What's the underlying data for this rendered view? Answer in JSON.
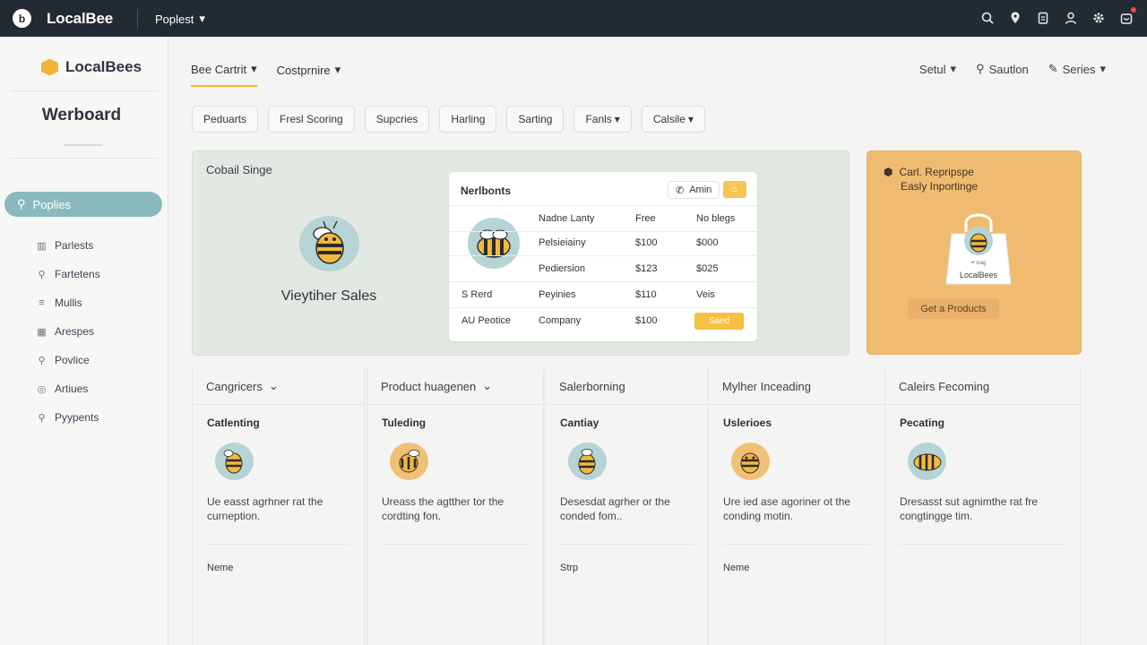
{
  "topbar": {
    "brand": "LocalBee",
    "project": "Poplest"
  },
  "sidebar": {
    "logo": "LocalBees",
    "title": "Werboard",
    "active": "Poplies",
    "items": [
      {
        "label": "Parlests",
        "icon": "chart-icon"
      },
      {
        "label": "Fartetens",
        "icon": "search-icon"
      },
      {
        "label": "Mullis",
        "icon": "list-icon"
      },
      {
        "label": "Arespes",
        "icon": "grid-icon"
      },
      {
        "label": "Povlice",
        "icon": "search-icon"
      },
      {
        "label": "Artiues",
        "icon": "target-icon"
      },
      {
        "label": "Pyypents",
        "icon": "pin-icon"
      }
    ]
  },
  "subnav": {
    "tabs": [
      {
        "label": "Bee Cartrit"
      },
      {
        "label": "Costprnire"
      }
    ],
    "right": {
      "setup": "Setul",
      "search": "Sautlon",
      "series": "Series"
    }
  },
  "chips": [
    "Peduarts",
    "Fresl Scoring",
    "Supcries",
    "Harling",
    "Sarting",
    "Fanls",
    "Calsile"
  ],
  "hero": {
    "label": "Cobail Singe",
    "sales_title": "Vieytiher Sales",
    "card": {
      "title": "Nerlbonts",
      "admin": "Amin",
      "headers": [
        "",
        "Nadne Lanty",
        "Free",
        "No blegs"
      ],
      "rows": [
        [
          "",
          "Pelsieiainy",
          "$100",
          "$000"
        ],
        [
          "",
          "Pediersion",
          "$123",
          "$025"
        ],
        [
          "S Rerd",
          "Peyinies",
          "$110",
          "Veis"
        ],
        [
          "AU Peotice",
          "Company",
          "$100",
          "Saed"
        ]
      ]
    }
  },
  "promo": {
    "title1": "Carl. Repripspe",
    "title2": "Easly Inportinge",
    "bag_text": "LocalBees",
    "bag_small": "•• lcag",
    "button": "Get a Products"
  },
  "columns": [
    {
      "header": "Cangricers",
      "dropdown": true,
      "sub": "Catlenting",
      "desc": "Ue easst agrhner rat the curneption.",
      "foot": "Neme",
      "bee_bg": "#b6d3d5"
    },
    {
      "header": "Product huagenen",
      "dropdown": true,
      "sub": "Tuleding",
      "desc": "Ureass the agtther tor the cordting fon.",
      "foot": "",
      "bee_bg": "#f1c077"
    },
    {
      "header": "Salerborning",
      "dropdown": false,
      "sub": "Cantiay",
      "desc": "Desesdat agrher or the conded fom..",
      "foot": "Strp",
      "bee_bg": "#b6d3d5"
    },
    {
      "header": "Mylher Inceading",
      "dropdown": false,
      "sub": "Uslerioes",
      "desc": "Ure ied ase agoriner ot the conding motin.",
      "foot": "Neme",
      "bee_bg": "#f1c077"
    },
    {
      "header": "Caleirs Fecoming",
      "dropdown": false,
      "sub": "Pecating",
      "desc": "Dresasst sut agnimthe rat fre congtingge tim.",
      "foot": "",
      "bee_bg": "#b6d3d5"
    }
  ]
}
